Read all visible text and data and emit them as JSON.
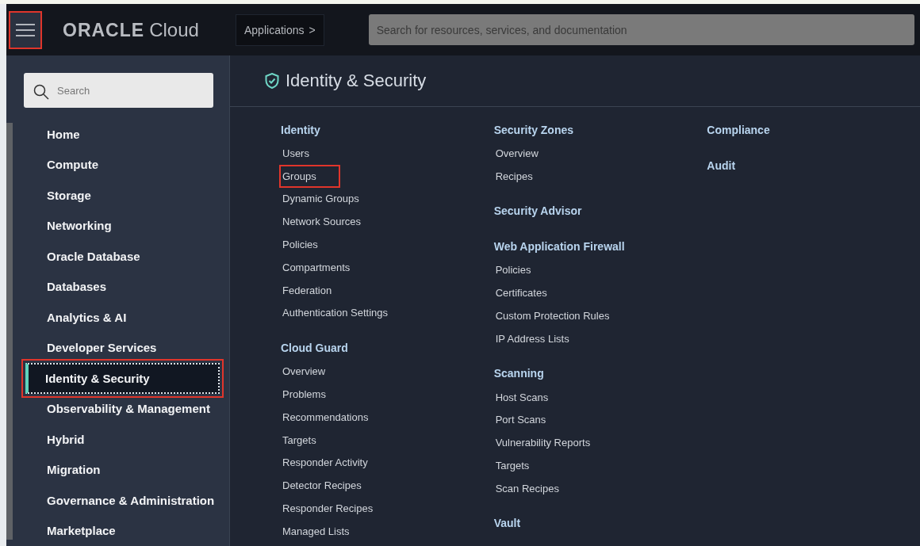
{
  "header": {
    "menu_button": {
      "highlighted": true
    },
    "logo": {
      "brand": "ORACLE",
      "product": "Cloud"
    },
    "applications_button": {
      "label": "Applications",
      "caret": ">"
    },
    "search": {
      "placeholder": "Search for resources, services, and documentation"
    }
  },
  "sidebar": {
    "search": {
      "placeholder": "Search"
    },
    "items": [
      {
        "label": "Home",
        "selected": false,
        "highlighted": false
      },
      {
        "label": "Compute",
        "selected": false,
        "highlighted": false
      },
      {
        "label": "Storage",
        "selected": false,
        "highlighted": false
      },
      {
        "label": "Networking",
        "selected": false,
        "highlighted": false
      },
      {
        "label": "Oracle Database",
        "selected": false,
        "highlighted": false
      },
      {
        "label": "Databases",
        "selected": false,
        "highlighted": false
      },
      {
        "label": "Analytics & AI",
        "selected": false,
        "highlighted": false
      },
      {
        "label": "Developer Services",
        "selected": false,
        "highlighted": false
      },
      {
        "label": "Identity & Security",
        "selected": true,
        "highlighted": true
      },
      {
        "label": "Observability & Management",
        "selected": false,
        "highlighted": false
      },
      {
        "label": "Hybrid",
        "selected": false,
        "highlighted": false
      },
      {
        "label": "Migration",
        "selected": false,
        "highlighted": false
      },
      {
        "label": "Governance & Administration",
        "selected": false,
        "highlighted": false
      },
      {
        "label": "Marketplace",
        "selected": false,
        "highlighted": false
      }
    ]
  },
  "main": {
    "title": "Identity & Security",
    "columns": [
      [
        {
          "heading": "Identity",
          "items": [
            {
              "label": "Users",
              "highlighted": false
            },
            {
              "label": "Groups",
              "highlighted": true
            },
            {
              "label": "Dynamic Groups",
              "highlighted": false
            },
            {
              "label": "Network Sources",
              "highlighted": false
            },
            {
              "label": "Policies",
              "highlighted": false
            },
            {
              "label": "Compartments",
              "highlighted": false
            },
            {
              "label": "Federation",
              "highlighted": false
            },
            {
              "label": "Authentication Settings",
              "highlighted": false
            }
          ]
        },
        {
          "heading": "Cloud Guard",
          "items": [
            {
              "label": "Overview",
              "highlighted": false
            },
            {
              "label": "Problems",
              "highlighted": false
            },
            {
              "label": "Recommendations",
              "highlighted": false
            },
            {
              "label": "Targets",
              "highlighted": false
            },
            {
              "label": "Responder Activity",
              "highlighted": false
            },
            {
              "label": "Detector Recipes",
              "highlighted": false
            },
            {
              "label": "Responder Recipes",
              "highlighted": false
            },
            {
              "label": "Managed Lists",
              "highlighted": false
            }
          ]
        }
      ],
      [
        {
          "heading": "Security Zones",
          "items": [
            {
              "label": "Overview",
              "highlighted": false
            },
            {
              "label": "Recipes",
              "highlighted": false
            }
          ]
        },
        {
          "heading": "Security Advisor"
        },
        {
          "heading": "Web Application Firewall",
          "items": [
            {
              "label": "Policies",
              "highlighted": false
            },
            {
              "label": "Certificates",
              "highlighted": false
            },
            {
              "label": "Custom Protection Rules",
              "highlighted": false
            },
            {
              "label": "IP Address Lists",
              "highlighted": false
            }
          ]
        },
        {
          "heading": "Scanning",
          "items": [
            {
              "label": "Host Scans",
              "highlighted": false
            },
            {
              "label": "Port Scans",
              "highlighted": false
            },
            {
              "label": "Vulnerability Reports",
              "highlighted": false
            },
            {
              "label": "Targets",
              "highlighted": false
            },
            {
              "label": "Scan Recipes",
              "highlighted": false
            }
          ]
        },
        {
          "heading": "Vault"
        }
      ],
      [
        {
          "heading": "Compliance"
        },
        {
          "heading": "Audit"
        }
      ]
    ]
  }
}
